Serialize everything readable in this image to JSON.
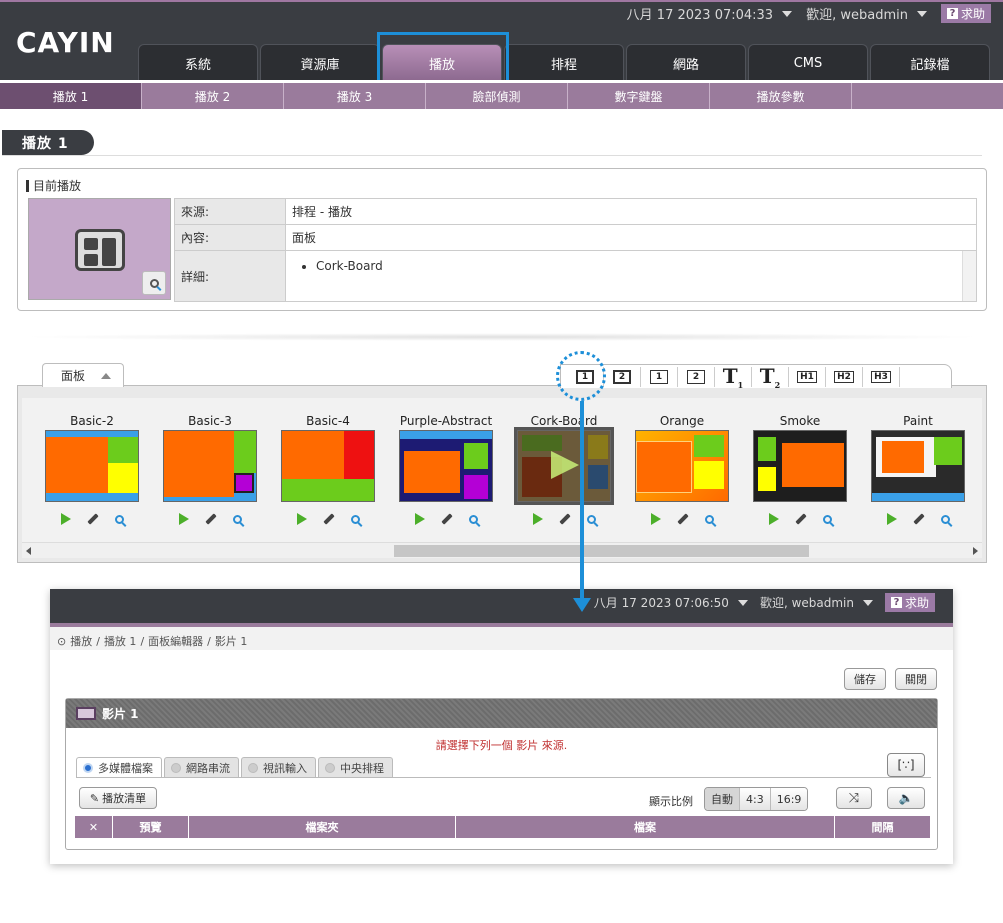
{
  "app": {
    "logo": "CAYIN",
    "status": {
      "datetime": "八月 17 2023 07:04:33",
      "welcome": "歡迎, webadmin",
      "help": "求助",
      "help_icon_glyph": "?"
    },
    "main_tabs": [
      "系統",
      "資源庫",
      "播放",
      "排程",
      "網路",
      "CMS",
      "記錄檔"
    ],
    "active_main_tab": "播放",
    "sub_tabs": [
      "播放 1",
      "播放 2",
      "播放 3",
      "臉部偵測",
      "數字鍵盤",
      "播放參數"
    ],
    "active_sub_tab": "播放 1",
    "page_title": "播放 1",
    "now_playing": {
      "label": "目前播放",
      "rows": [
        {
          "key": "來源:",
          "value": "排程 - 播放"
        },
        {
          "key": "內容:",
          "value": "面板"
        },
        {
          "key": "詳細:",
          "value": "Cork-Board"
        }
      ]
    },
    "library": {
      "tab_label": "面板",
      "tools": [
        "1",
        "2",
        "1",
        "2",
        "T1",
        "T2",
        "H1",
        "H2",
        "H3"
      ],
      "items": [
        {
          "name": "Basic-2"
        },
        {
          "name": "Basic-3"
        },
        {
          "name": "Basic-4"
        },
        {
          "name": "Purple-Abstract"
        },
        {
          "name": "Cork-Board"
        },
        {
          "name": "Orange"
        },
        {
          "name": "Smoke"
        },
        {
          "name": "Paint"
        }
      ],
      "selected_item": "Cork-Board"
    }
  },
  "editor": {
    "status": {
      "datetime": "八月 17 2023 07:06:50",
      "welcome": "歡迎, webadmin",
      "help": "求助"
    },
    "breadcrumb": [
      "播放",
      "播放 1",
      "面板編輯器",
      "影片 1"
    ],
    "buttons": {
      "save": "儲存",
      "close": "關閉"
    },
    "panel_title": "影片 1",
    "warning": "請選擇下列一個 影片 來源.",
    "source_tabs": [
      {
        "label": "多媒體檔案",
        "selected": true
      },
      {
        "label": "網路串流",
        "selected": false
      },
      {
        "label": "視訊輸入",
        "selected": false
      },
      {
        "label": "中央排程",
        "selected": false
      }
    ],
    "playlist_button": "播放清單",
    "aspect_label": "顯示比例",
    "aspect_options": [
      "自動",
      "4:3",
      "16:9"
    ],
    "aspect_selected": "自動",
    "table_headers": [
      "預覽",
      "檔案夾",
      "檔案",
      "間隔"
    ]
  },
  "colors": {
    "dark_bar": "#3a3d42",
    "purple": "#9a7b9c",
    "highlight_blue": "#1d8fd8",
    "warning_red": "#c03030"
  }
}
